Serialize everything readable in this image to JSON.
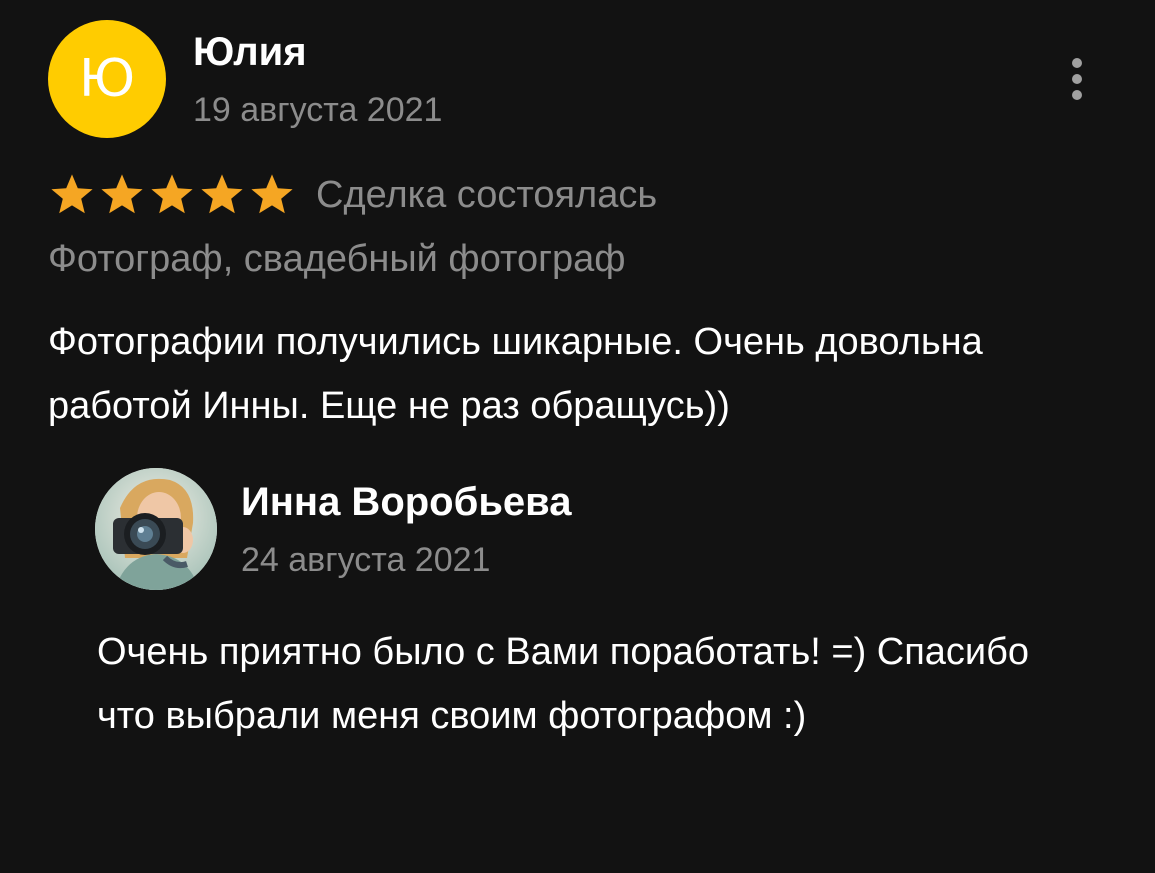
{
  "review": {
    "author": {
      "initial": "Ю",
      "name": "Юлия",
      "date": "19 августа 2021",
      "avatar_color": "#ffcc00"
    },
    "more_icon": "more-vertical-icon",
    "rating": {
      "stars": 5,
      "max_stars": 5,
      "star_icon": "star-icon",
      "star_color": "#f5a623"
    },
    "deal_status": "Сделка состоялась",
    "category": "Фотограф, свадебный фотограф",
    "text": "Фотографии получились шикарные. Очень довольна работой Инны. Еще не раз обращусь))"
  },
  "reply": {
    "author": {
      "name": "Инна Воробьева",
      "date": "24 августа 2021",
      "avatar": "photographer-photo-avatar"
    },
    "text": "Очень приятно было с Вами поработать! =) Спасибо что выбрали меня своим фотографом :)"
  },
  "colors": {
    "background": "#121212",
    "primary_text": "#ffffff",
    "secondary_text": "#8c8c8c"
  }
}
